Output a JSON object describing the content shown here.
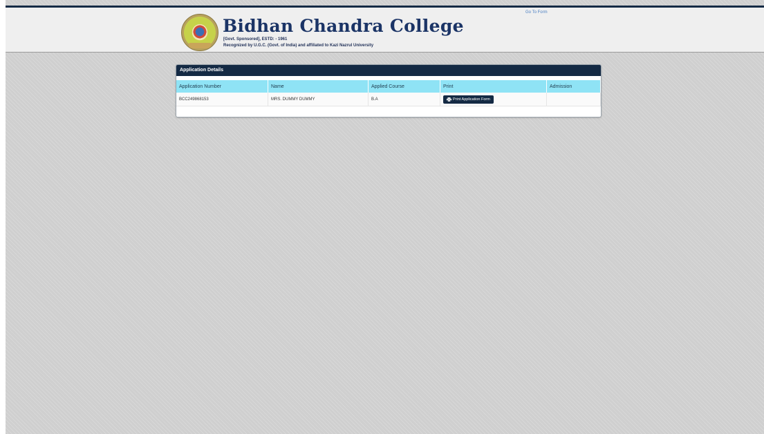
{
  "header": {
    "college_name": "Bidhan Chandra College",
    "line1": "[Govt. Sponsored], ESTD: - 1961",
    "line2": "Recognized by U.G.C. (Govt. of India) and affiliated to Kazi Nazrul University",
    "go_to_form": "Go To Form"
  },
  "panel": {
    "title": "Application Details",
    "columns": [
      "Application Number",
      "Name",
      "Applied Course",
      "Print",
      "Admission"
    ],
    "rows": [
      {
        "application_number": "BCC249868153",
        "name": "MRS. DUMMY DUMMY",
        "applied_course": "B.A",
        "print_button": "Print Application Form",
        "admission": ""
      }
    ]
  },
  "colors": {
    "navy": "#142a44",
    "table_header": "#8fe3f5",
    "background": "#cfcfcf",
    "title_text": "#1b3466"
  },
  "icons": [
    "college-logo",
    "printer-icon"
  ]
}
